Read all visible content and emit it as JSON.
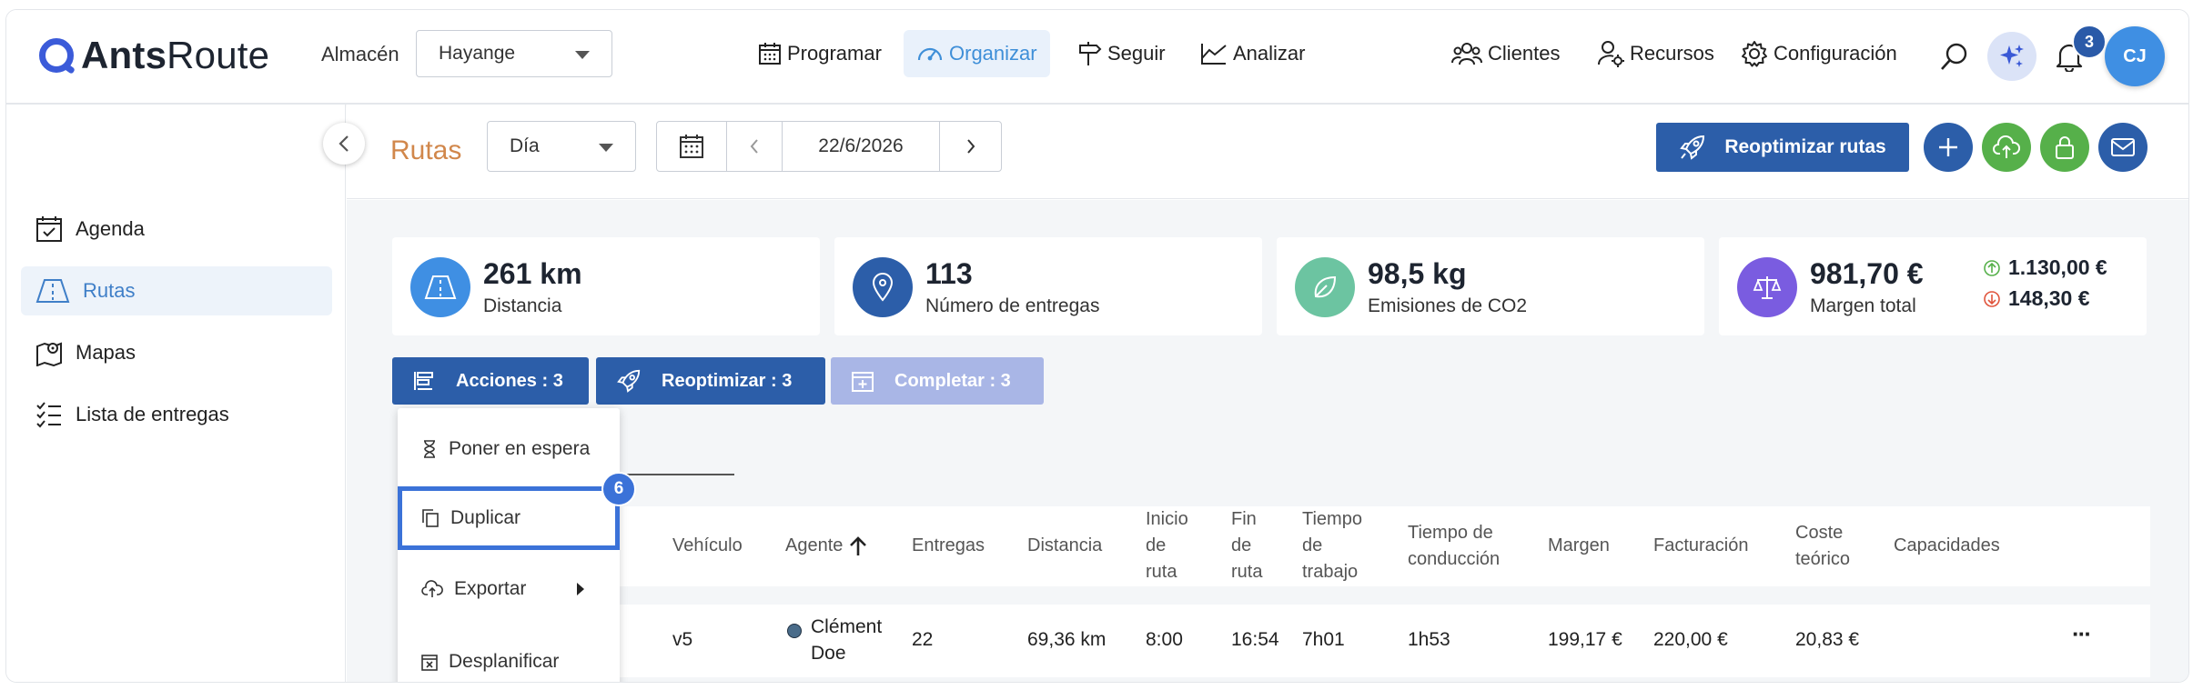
{
  "app": {
    "brand_bold": "Ants",
    "brand_light": "Route"
  },
  "header": {
    "almacen_label": "Almacén",
    "almacen_value": "Hayange",
    "nav": {
      "programar": "Programar",
      "organizar": "Organizar",
      "seguir": "Seguir",
      "analizar": "Analizar"
    },
    "right_nav": {
      "clientes": "Clientes",
      "recursos": "Recursos",
      "configuracion": "Configuración"
    },
    "notifications_count": "3",
    "avatar_initials": "CJ"
  },
  "sidebar": {
    "items": [
      {
        "label": "Agenda",
        "icon": "calendar-check-icon"
      },
      {
        "label": "Rutas",
        "icon": "road-icon",
        "active": true
      },
      {
        "label": "Mapas",
        "icon": "map-pin-icon"
      },
      {
        "label": "Lista de entregas",
        "icon": "checklist-icon"
      }
    ]
  },
  "toolbar": {
    "title": "Rutas",
    "period": "Día",
    "date": "22/6/2026",
    "reoptimize_label": "Reoptimizar rutas"
  },
  "stats": {
    "distance": {
      "value": "261 km",
      "label": "Distancia"
    },
    "deliveries": {
      "value": "113",
      "label": "Número de entregas"
    },
    "co2": {
      "value": "98,5 kg",
      "label": "Emisiones de CO2"
    },
    "margin": {
      "value": "981,70 €",
      "label": "Margen total",
      "up": "1.130,00 €",
      "down": "148,30 €"
    }
  },
  "actions": {
    "acciones": "Acciones : 3",
    "reoptimizar": "Reoptimizar : 3",
    "completar": "Completar : 3"
  },
  "menu": {
    "items": [
      "Poner en espera",
      "Duplicar",
      "Exportar",
      "Desplanificar"
    ],
    "step_badge": "6"
  },
  "table": {
    "headers": {
      "vehiculo": "Vehículo",
      "agente": "Agente",
      "entregas": "Entregas",
      "distancia": "Distancia",
      "inicio": [
        "Inicio",
        "de",
        "ruta"
      ],
      "fin": [
        "Fin",
        "de",
        "ruta"
      ],
      "tiempo_trabajo": [
        "Tiempo",
        "de",
        "trabajo"
      ],
      "tiempo_conduccion": [
        "Tiempo de",
        "conducción"
      ],
      "margen": "Margen",
      "facturacion": "Facturación",
      "coste": [
        "Coste",
        "teórico"
      ],
      "capacidades": "Capacidades"
    },
    "rows": [
      {
        "vehiculo": "v5",
        "agente": [
          "Clément",
          "Doe"
        ],
        "entregas": "22",
        "distancia": "69,36 km",
        "inicio": "8:00",
        "fin": "16:54",
        "tiempo_trabajo": "7h01",
        "tiempo_conduccion": "1h53",
        "margen": "199,17 €",
        "facturacion": "220,00 €",
        "coste": "20,83 €",
        "more": "···"
      }
    ]
  },
  "colors": {
    "primary": "#2c5ea9",
    "accent_orange": "#d1874b",
    "green": "#56b04a",
    "active_nav": "#3f8fd8"
  }
}
